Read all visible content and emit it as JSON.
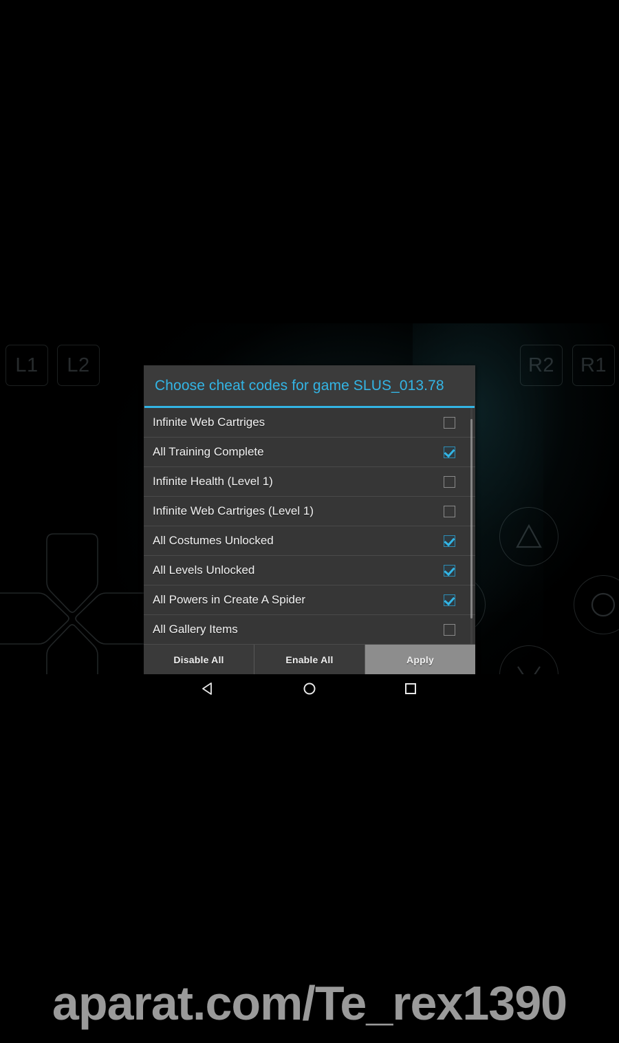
{
  "colors": {
    "accent": "#33b5e5",
    "dialog_bg": "#3a3a3a",
    "list_bg": "#363636",
    "row_text": "#f2f2f2",
    "highlight_bg": "#8d8d8d",
    "screen_bg": "#000000",
    "watermark_text": "#9a9a9a"
  },
  "dialog": {
    "title": "Choose cheat codes for game SLUS_013.78",
    "rows": [
      {
        "label": "Infinite Web Cartriges",
        "checked": false
      },
      {
        "label": "All Training Complete",
        "checked": true
      },
      {
        "label": "Infinite Health (Level 1)",
        "checked": false
      },
      {
        "label": "Infinite Web Cartriges (Level 1)",
        "checked": false
      },
      {
        "label": "All Costumes Unlocked",
        "checked": true
      },
      {
        "label": "All Levels Unlocked",
        "checked": true
      },
      {
        "label": "All Powers in Create A Spider",
        "checked": true
      },
      {
        "label": "All Gallery Items",
        "checked": false
      }
    ],
    "buttons": [
      {
        "label": "Disable All",
        "highlighted": false
      },
      {
        "label": "Enable All",
        "highlighted": false
      },
      {
        "label": "Apply",
        "highlighted": true
      }
    ]
  },
  "gamepad": {
    "shoulders": [
      {
        "id": "l1",
        "label": "L1"
      },
      {
        "id": "l2",
        "label": "L2"
      },
      {
        "id": "r2",
        "label": "R2"
      },
      {
        "id": "r1",
        "label": "R1"
      }
    ],
    "face_buttons": [
      "triangle",
      "circle",
      "square",
      "cross"
    ],
    "dpad": "dpad-cross"
  },
  "navbar": {
    "buttons": [
      "back",
      "home",
      "recents"
    ]
  },
  "watermark": {
    "text": "aparat.com/Te_rex1390"
  }
}
